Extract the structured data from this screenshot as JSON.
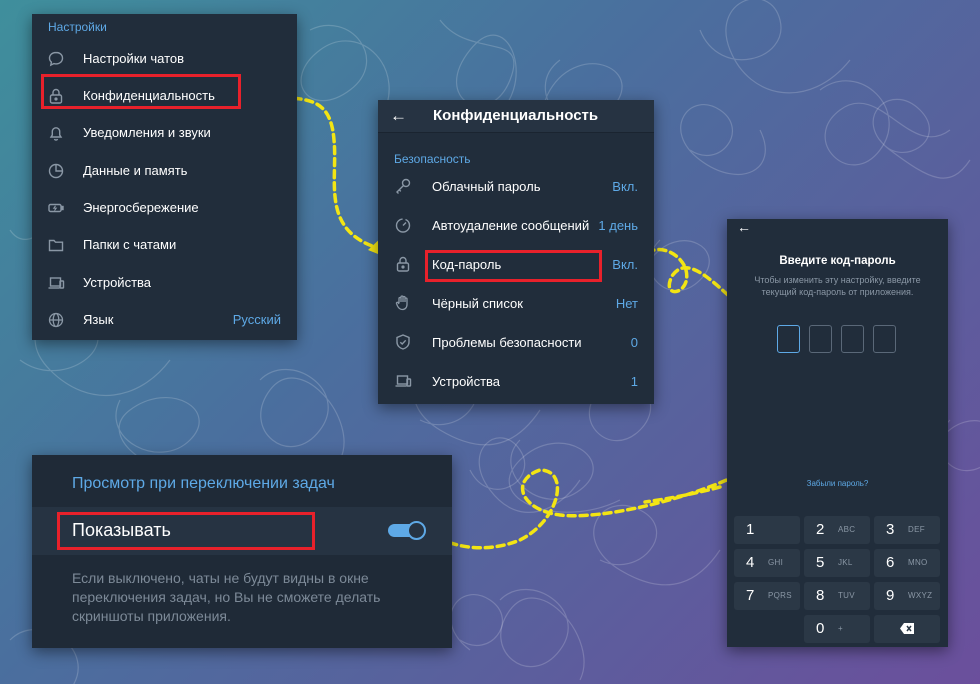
{
  "settings": {
    "section": "Настройки",
    "items": [
      {
        "label": "Настройки чатов",
        "icon": "chat-bubble-icon",
        "value": ""
      },
      {
        "label": "Конфиденциальность",
        "icon": "lock-icon",
        "value": ""
      },
      {
        "label": "Уведомления и звуки",
        "icon": "bell-icon",
        "value": ""
      },
      {
        "label": "Данные и память",
        "icon": "pie-chart-icon",
        "value": ""
      },
      {
        "label": "Энергосбережение",
        "icon": "battery-icon",
        "value": ""
      },
      {
        "label": "Папки с чатами",
        "icon": "folder-icon",
        "value": ""
      },
      {
        "label": "Устройства",
        "icon": "devices-icon",
        "value": ""
      },
      {
        "label": "Язык",
        "icon": "globe-icon",
        "value": "Русский"
      }
    ]
  },
  "privacy": {
    "title": "Конфиденциальность",
    "section": "Безопасность",
    "items": [
      {
        "label": "Облачный пароль",
        "icon": "key-icon",
        "value": "Вкл."
      },
      {
        "label": "Автоудаление сообщений",
        "icon": "timer-icon",
        "value": "1 день"
      },
      {
        "label": "Код-пароль",
        "icon": "lock-icon",
        "value": "Вкл."
      },
      {
        "label": "Чёрный список",
        "icon": "hand-icon",
        "value": "Нет"
      },
      {
        "label": "Проблемы безопасности",
        "icon": "shield-icon",
        "value": "0"
      },
      {
        "label": "Устройства",
        "icon": "devices-icon",
        "value": "1"
      }
    ]
  },
  "passcode": {
    "title": "Введите код-пароль",
    "subtitle_line1": "Чтобы изменить эту настройку, введите",
    "subtitle_line2": "текущий код-пароль от приложения.",
    "forgot": "Забыли пароль?",
    "keys": [
      {
        "digit": "1",
        "letters": ""
      },
      {
        "digit": "2",
        "letters": "ABC"
      },
      {
        "digit": "3",
        "letters": "DEF"
      },
      {
        "digit": "4",
        "letters": "GHI"
      },
      {
        "digit": "5",
        "letters": "JKL"
      },
      {
        "digit": "6",
        "letters": "MNO"
      },
      {
        "digit": "7",
        "letters": "PQRS"
      },
      {
        "digit": "8",
        "letters": "TUV"
      },
      {
        "digit": "9",
        "letters": "WXYZ"
      },
      {
        "digit": "0",
        "letters": "+"
      }
    ]
  },
  "app_switcher": {
    "title": "Просмотр при переключении задач",
    "toggle_label": "Показывать",
    "toggle_on": true,
    "desc_line1": "Если выключено, чаты не будут видны в окне",
    "desc_line2": "переключения задач, но Вы не сможете делать",
    "desc_line3": "скриншоты приложения."
  },
  "colors": {
    "accent": "#5ea9e6",
    "highlight": "#e8212b",
    "arrow": "#f3e513",
    "panel": "#212d3b"
  }
}
